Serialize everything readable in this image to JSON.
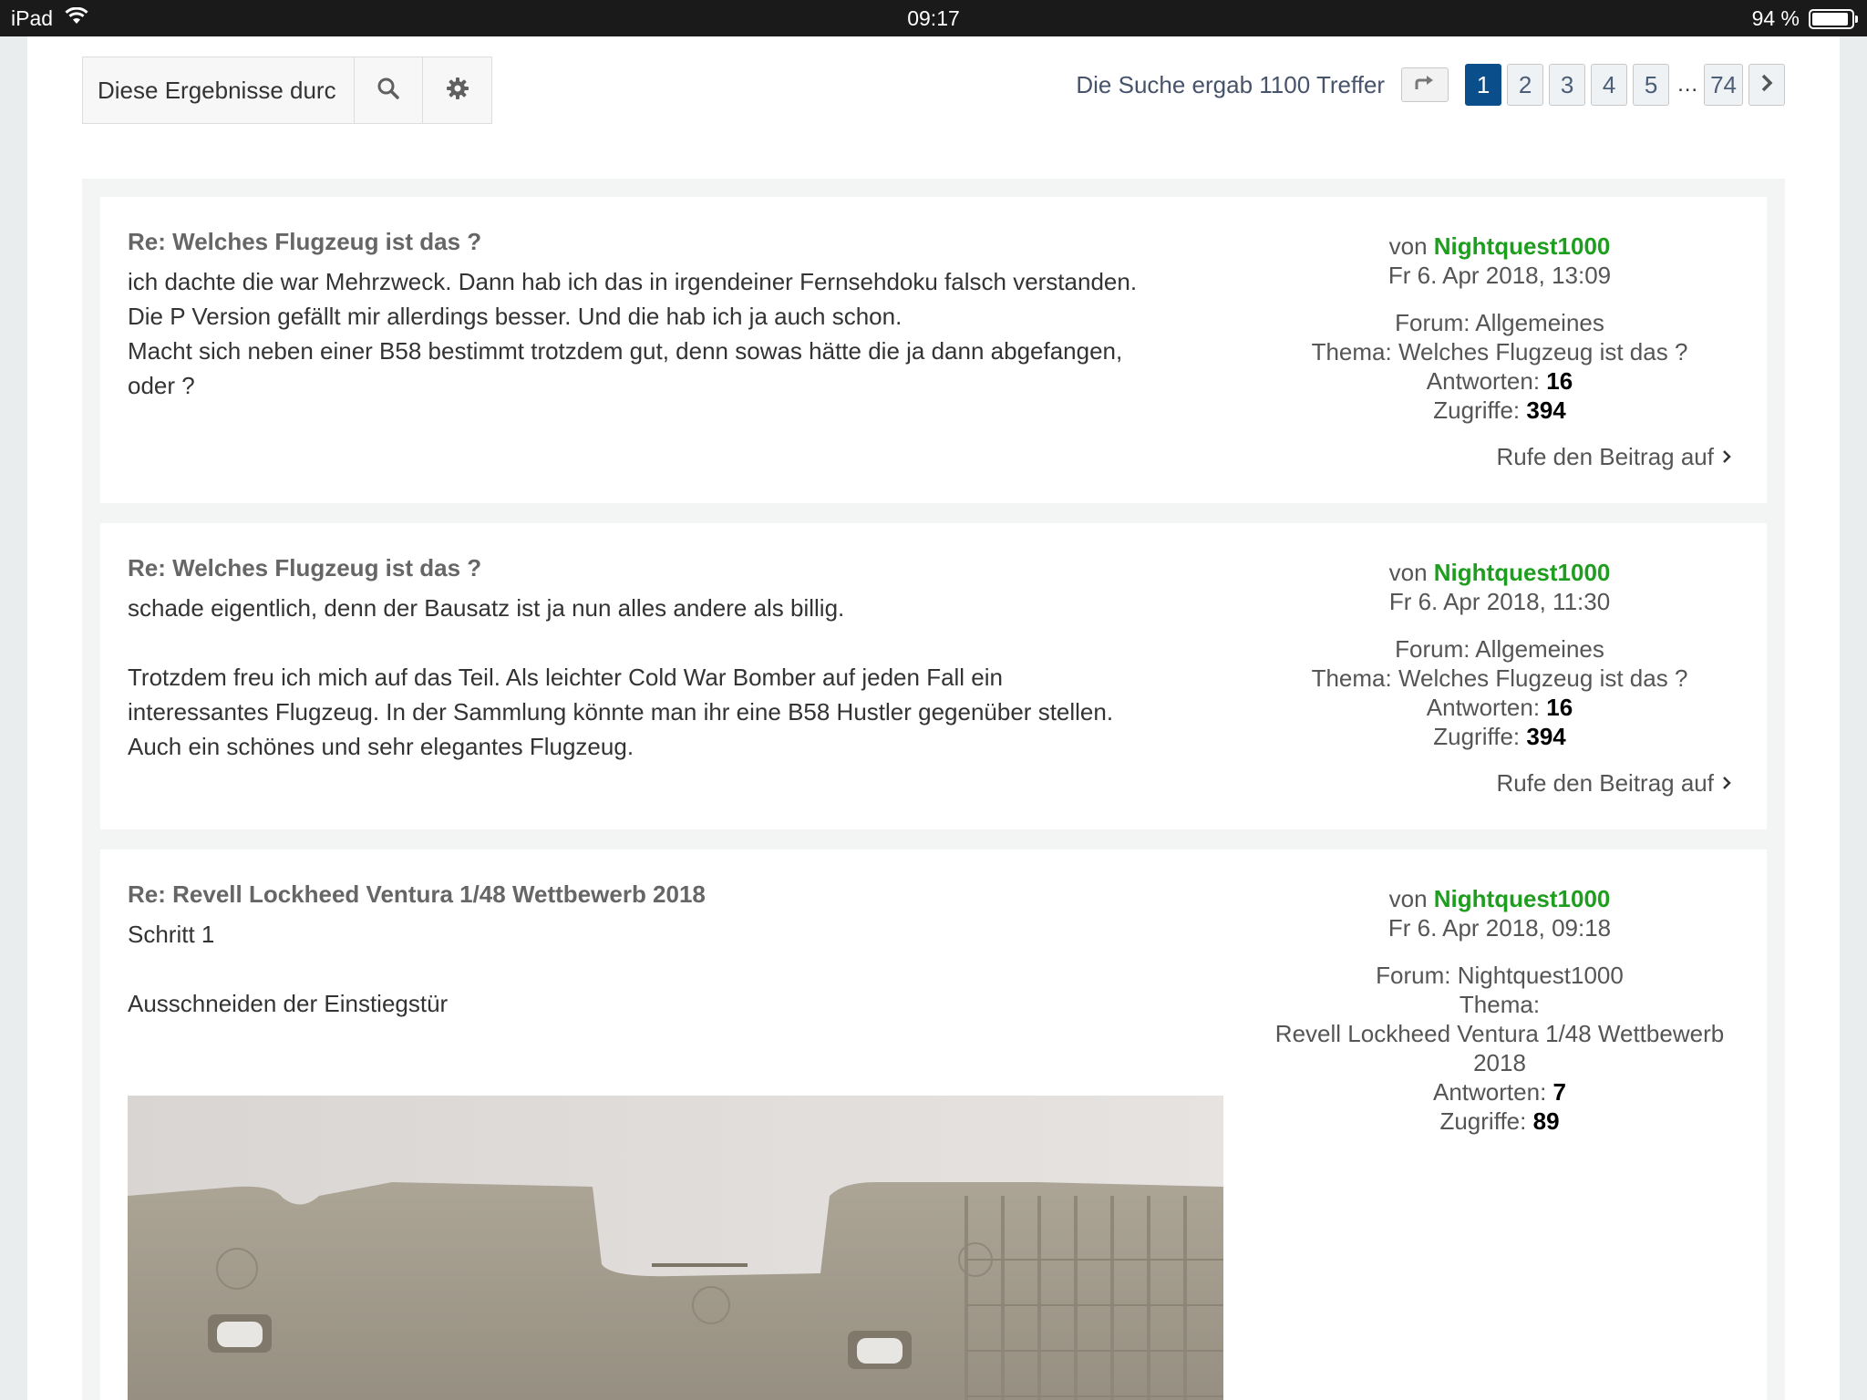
{
  "status_bar": {
    "device": "iPad",
    "time": "09:17",
    "battery": "94 %",
    "battery_level": 0.94
  },
  "search": {
    "value": "Diese Ergebnisse durc"
  },
  "pagination": {
    "result_count": "Die Suche ergab 1100 Treffer",
    "pages": [
      "1",
      "2",
      "3",
      "4",
      "5"
    ],
    "ellipsis": "…",
    "last_page": "74",
    "current": "1"
  },
  "posts": [
    {
      "title": "Re: Welches Flugzeug ist das ?",
      "lines": [
        "ich dachte die war Mehrzweck. Dann hab ich das in irgendeiner Fernsehdoku falsch verstanden.",
        "Die P Version gefällt mir allerdings besser. Und die hab ich ja auch schon.",
        "Macht sich neben einer B58 bestimmt trotzdem gut, denn sowas hätte die ja dann abgefangen,",
        "oder ?"
      ],
      "by_label": "von",
      "author": "Nightquest1000",
      "date": "Fr 6. Apr 2018, 13:09",
      "forum": "Forum: Allgemeines",
      "topic": "Thema: Welches Flugzeug ist das ?",
      "replies_label": "Antworten:",
      "replies": "16",
      "views_label": "Zugriffe:",
      "views": "394",
      "view_link": "Rufe den Beitrag auf"
    },
    {
      "title": "Re: Welches Flugzeug ist das ?",
      "lines": [
        "schade eigentlich, denn der Bausatz ist ja nun alles andere als billig.",
        "",
        "Trotzdem freu ich mich auf das Teil. Als leichter Cold War Bomber auf jeden Fall ein",
        "interessantes Flugzeug. In der Sammlung könnte man ihr eine B58 Hustler gegenüber stellen.",
        "Auch ein schönes und sehr elegantes Flugzeug."
      ],
      "by_label": "von",
      "author": "Nightquest1000",
      "date": "Fr 6. Apr 2018, 11:30",
      "forum": "Forum: Allgemeines",
      "topic": "Thema: Welches Flugzeug ist das ?",
      "replies_label": "Antworten:",
      "replies": "16",
      "views_label": "Zugriffe:",
      "views": "394",
      "view_link": "Rufe den Beitrag auf"
    },
    {
      "title": "Re: Revell Lockheed Ventura 1/48 Wettbewerb 2018",
      "lines": [
        "Schritt 1",
        "",
        "Ausschneiden der Einstiegstür"
      ],
      "by_label": "von",
      "author": "Nightquest1000",
      "date": "Fr 6. Apr 2018, 09:18",
      "forum": "Forum: Nightquest1000",
      "topic_label": "Thema:",
      "topic_line1": "Revell Lockheed Ventura 1/48 Wettbewerb",
      "topic_line2": "2018",
      "replies_label": "Antworten:",
      "replies": "7",
      "views_label": "Zugriffe:",
      "views": "89"
    }
  ],
  "colors": {
    "accent": "#0b4e8c",
    "username": "#1e9e1e",
    "photo_part": "#a29d90"
  }
}
